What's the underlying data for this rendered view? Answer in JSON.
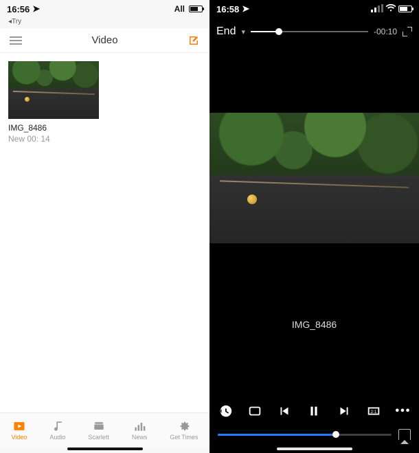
{
  "left": {
    "status": {
      "time": "16:56",
      "net_label": "All"
    },
    "breadcrumb": "◂Try",
    "header": {
      "menu_name": "menu",
      "title": "Video",
      "edit_name": "edit"
    },
    "item": {
      "name": "IMG_8486",
      "meta": "New 00: 14"
    },
    "tabs": [
      {
        "icon": "play",
        "label": "Video",
        "active": true
      },
      {
        "icon": "note",
        "label": "Audio",
        "active": false
      },
      {
        "icon": "folder",
        "label": "Scarlett",
        "active": false
      },
      {
        "icon": "bars",
        "label": "News",
        "active": false
      },
      {
        "icon": "gear",
        "label": "Get Times",
        "active": false
      }
    ]
  },
  "right": {
    "status": {
      "time": "16:58"
    },
    "header": {
      "label": "End",
      "volume_percent": 24,
      "time_remaining": "-00:10"
    },
    "video": {
      "name": "IMG_8486"
    },
    "progress_percent": 68,
    "controls": {
      "history": "history",
      "repeat": "repeat",
      "prev": "previous",
      "pause": "pause",
      "next": "next",
      "aspect": "aspect-ratio",
      "more": "more"
    }
  }
}
